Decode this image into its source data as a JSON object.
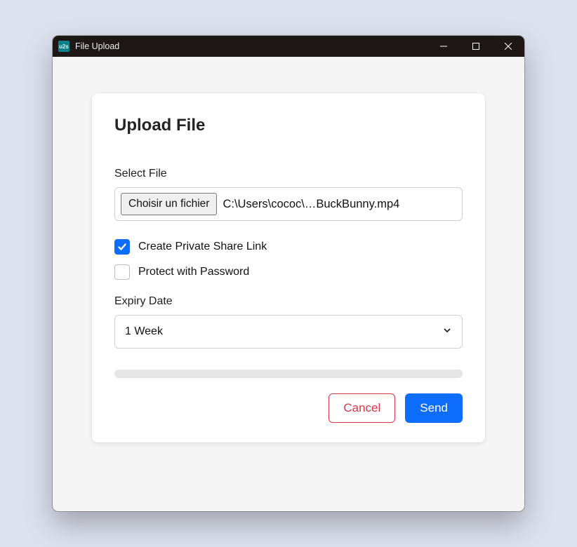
{
  "window": {
    "title": "File Upload",
    "app_icon_text": "u2s"
  },
  "card": {
    "heading": "Upload File",
    "select_file_label": "Select File",
    "choose_button": "Choisir un fichier",
    "file_name": "C:\\Users\\cococ\\…BuckBunny.mp4",
    "private_share_label": "Create Private Share Link",
    "private_share_checked": true,
    "password_label": "Protect with Password",
    "password_checked": false,
    "expiry_label": "Expiry Date",
    "expiry_value": "1 Week",
    "cancel": "Cancel",
    "send": "Send"
  },
  "colors": {
    "accent": "#0d6efd",
    "danger": "#dc3545"
  }
}
